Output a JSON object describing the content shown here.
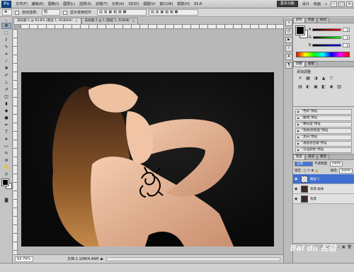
{
  "menu": {
    "logo": "Ps",
    "items": [
      "文件(F)",
      "编辑(E)",
      "图像(I)",
      "图层(L)",
      "选择(S)",
      "滤镜(T)",
      "分析(A)",
      "3D(D)",
      "视图(V)",
      "窗口(W)",
      "帮助(H)"
    ],
    "zoom_value": "93.8",
    "workspace_button": "基本功能",
    "workspace_items": [
      "设计",
      "绘画",
      "»"
    ],
    "window_controls": [
      "−",
      "□",
      "×"
    ]
  },
  "options": {
    "auto_select_label": "自动选择：",
    "auto_select_value": "组",
    "show_transform_label": "显示变换控件"
  },
  "document": {
    "tabs": [
      {
        "label": "未标题-1 @ 93.8% (图层 1, RGB/8#)",
        "close": "×"
      },
      {
        "label": "未标题-2 @ 1 (图层 1, RGB/8)",
        "close": "×"
      }
    ],
    "zoom": "93.79%",
    "doc_info": "文档:1.10M/4.46M"
  },
  "panels": {
    "color_tabs": [
      "颜色",
      "色板",
      "样式"
    ],
    "color_sliders": [
      {
        "label": "R",
        "value": "0",
        "gradient": "linear-gradient(90deg,#000,#f00)"
      },
      {
        "label": "G",
        "value": "0",
        "gradient": "linear-gradient(90deg,#000,#0f0)"
      },
      {
        "label": "B",
        "value": "0",
        "gradient": "linear-gradient(90deg,#000,#00f)"
      }
    ],
    "adjust_tabs": [
      "调整",
      "蒙版"
    ],
    "adjust_title": "添加调整",
    "adjust_icons_row1": [
      "☀",
      "▦",
      "◑",
      "▲",
      "▽"
    ],
    "adjust_icons_row2": [
      "▤",
      "◐",
      "▣",
      "◧",
      "◉",
      "▥"
    ],
    "presets": [
      "\"色阶\"预设",
      "\"曲线\"预设",
      "\"曝光度\"预设",
      "\"色相/饱和度\"预设",
      "\"黑白\"预设",
      "\"通道混合器\"预设",
      "\"可选颜色\"预设"
    ],
    "layers_tabs": [
      "图层",
      "通道",
      "路径"
    ],
    "blend_mode": "正常",
    "opacity_label": "不透明度:",
    "opacity_value": "100%",
    "lock_label": "锁定:",
    "fill_label": "填充:",
    "fill_value": "100%",
    "layers": [
      {
        "name": "图层 1",
        "active": true,
        "transparent": true
      },
      {
        "name": "背景 副本",
        "active": false,
        "transparent": false
      },
      {
        "name": "背景",
        "active": false,
        "transparent": false
      }
    ],
    "layer_footer_icons": [
      "∞",
      "fx",
      "◘",
      "◎",
      "▭",
      "▣",
      "🗑"
    ]
  },
  "watermark": "Bai du 经验"
}
